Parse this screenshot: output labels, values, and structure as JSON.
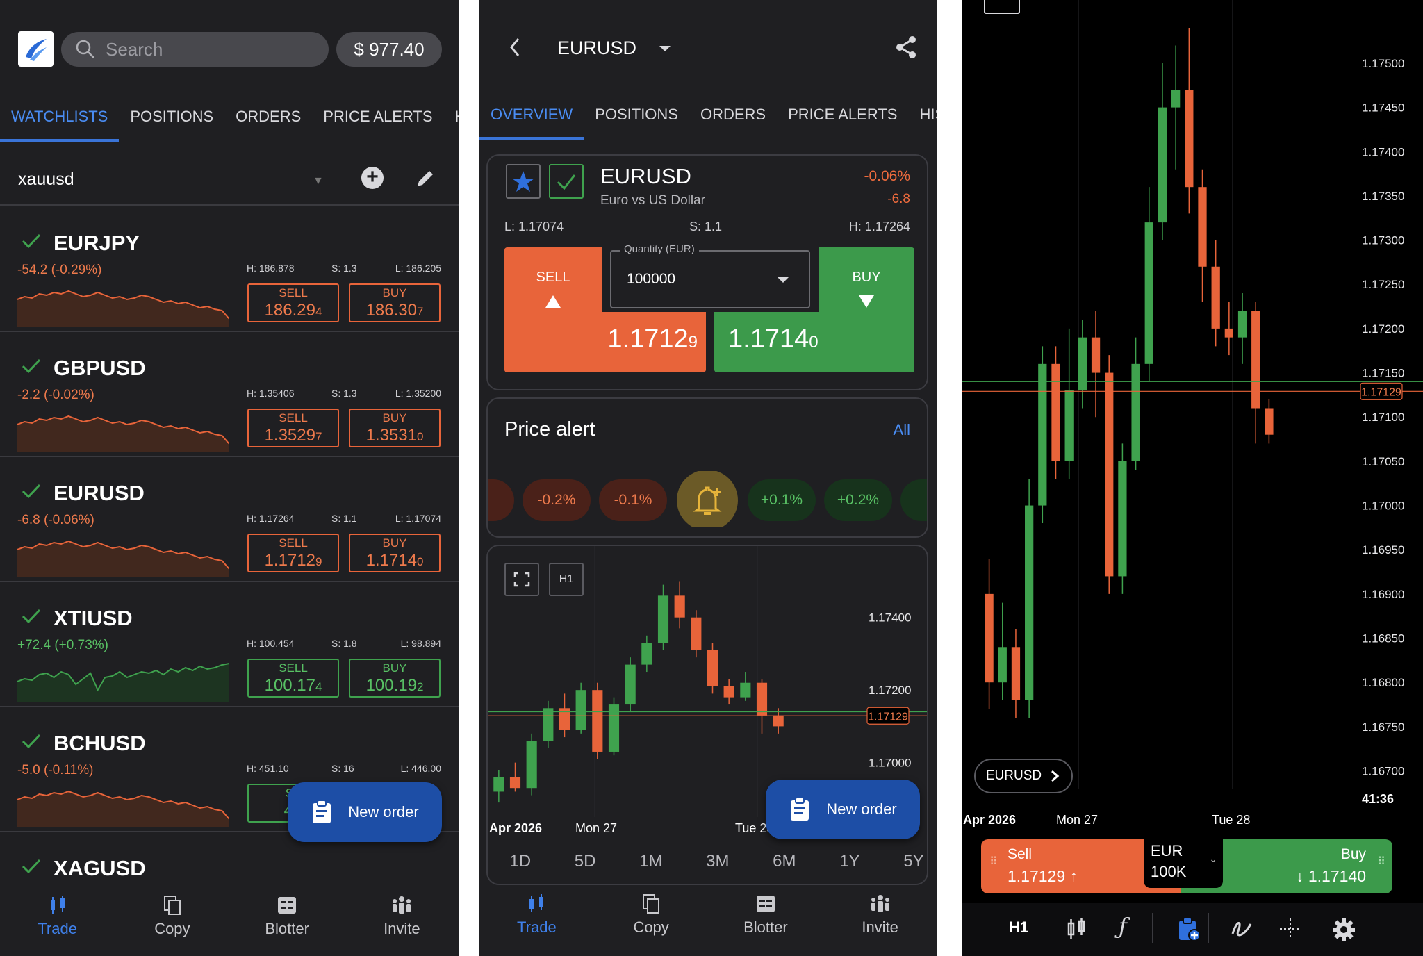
{
  "colors": {
    "accent": "#3a74d8",
    "sell": "#e8643a",
    "buy": "#3c9a4b",
    "panel_bg": "#1f1f22"
  },
  "panel1": {
    "search_placeholder": "Search",
    "balance": "$ 977.40",
    "tabs": [
      "WATCHLISTS",
      "POSITIONS",
      "ORDERS",
      "PRICE ALERTS",
      "HIS"
    ],
    "watchlist_name": "xauusd",
    "rows": [
      {
        "symbol": "EURJPY",
        "change": "-54.2 (-0.29%)",
        "trend": "down",
        "high": "H: 186.878",
        "spread": "S: 1.3",
        "low": "L: 186.205",
        "sell_label": "SELL",
        "sell_main": "186.29",
        "sell_pip": "4",
        "buy_label": "BUY",
        "buy_main": "186.30",
        "buy_pip": "7",
        "style": "orange"
      },
      {
        "symbol": "GBPUSD",
        "change": "-2.2 (-0.02%)",
        "trend": "down",
        "high": "H: 1.35406",
        "spread": "S: 1.3",
        "low": "L: 1.35200",
        "sell_label": "SELL",
        "sell_main": "1.3529",
        "sell_pip": "7",
        "buy_label": "BUY",
        "buy_main": "1.3531",
        "buy_pip": "0",
        "style": "orange"
      },
      {
        "symbol": "EURUSD",
        "change": "-6.8 (-0.06%)",
        "trend": "down",
        "high": "H: 1.17264",
        "spread": "S: 1.1",
        "low": "L: 1.17074",
        "sell_label": "SELL",
        "sell_main": "1.1712",
        "sell_pip": "9",
        "buy_label": "BUY",
        "buy_main": "1.1714",
        "buy_pip": "0",
        "style": "orange"
      },
      {
        "symbol": "XTIUSD",
        "change": "+72.4 (+0.73%)",
        "trend": "up",
        "high": "H: 100.454",
        "spread": "S: 1.8",
        "low": "L: 98.894",
        "sell_label": "SELL",
        "sell_main": "100.17",
        "sell_pip": "4",
        "buy_label": "BUY",
        "buy_main": "100.19",
        "buy_pip": "2",
        "style": "green"
      },
      {
        "symbol": "BCHUSD",
        "change": "-5.0 (-0.11%)",
        "trend": "down",
        "high": "H: 451.10",
        "spread": "S: 16",
        "low": "L: 446.00",
        "sell_label": "SE",
        "sell_main": "44",
        "sell_pip": "",
        "buy_label": "",
        "buy_main": "",
        "buy_pip": "",
        "style": "green"
      },
      {
        "symbol": "XAGUSD",
        "change": "",
        "trend": "",
        "high": "",
        "spread": "",
        "low": "",
        "sell_label": "",
        "sell_main": "",
        "sell_pip": "",
        "buy_label": "",
        "buy_main": "",
        "buy_pip": "",
        "style": "green"
      }
    ],
    "new_order": "New order",
    "nav": [
      "Trade",
      "Copy",
      "Blotter",
      "Invite"
    ]
  },
  "panel2": {
    "title": "EURUSD",
    "tabs": [
      "OVERVIEW",
      "POSITIONS",
      "ORDERS",
      "PRICE ALERTS",
      "HISTO"
    ],
    "symbol": "EURUSD",
    "description": "Euro vs US Dollar",
    "change_pct": "-0.06%",
    "change_abs": "-6.8",
    "low": "L: 1.17074",
    "spread": "S: 1.1",
    "high": "H: 1.17264",
    "sell_label": "SELL",
    "buy_label": "BUY",
    "quantity_label": "Quantity (EUR)",
    "quantity_value": "100000",
    "sell_main": "1.1712",
    "sell_pip": "9",
    "buy_main": "1.1714",
    "buy_pip": "0",
    "price_alert_title": "Price alert",
    "price_alert_all": "All",
    "chips": [
      "%",
      "-0.2%",
      "-0.1%",
      "+0.1%",
      "+0.2%",
      "+("
    ],
    "chart_timeframe": "H1",
    "timeframes": [
      "1D",
      "5D",
      "1M",
      "3M",
      "6M",
      "1Y",
      "5Y"
    ],
    "new_order": "New order",
    "nav": [
      "Trade",
      "Copy",
      "Blotter",
      "Invite"
    ]
  },
  "panel3": {
    "symbol_pill": "EURUSD",
    "time_label": "41:36",
    "sell_label": "Sell",
    "sell_price": "1.17129",
    "buy_label": "Buy",
    "buy_price": "1.17140",
    "currency": "EUR",
    "amount": "100K",
    "timeframe": "H1"
  },
  "chart_data": [
    {
      "type": "candlestick",
      "id": "overview-chart",
      "x_labels": [
        "Apr 2026",
        "Mon 27",
        "Tue 28"
      ],
      "y_ticks": [
        "1.17400",
        "1.17200",
        "1.17000"
      ],
      "current_sell": "1.17129",
      "current_buy": 1.1714,
      "ylim": [
        1.1685,
        1.1752
      ],
      "candles": [
        [
          1.1692,
          1.1696,
          1.1689,
          1.1698
        ],
        [
          1.1696,
          1.1693,
          1.1692,
          1.17
        ],
        [
          1.1693,
          1.1706,
          1.1691,
          1.1708
        ],
        [
          1.1706,
          1.1715,
          1.1704,
          1.1717
        ],
        [
          1.1715,
          1.1709,
          1.1707,
          1.1719
        ],
        [
          1.1709,
          1.172,
          1.1708,
          1.1722
        ],
        [
          1.172,
          1.1703,
          1.1701,
          1.1722
        ],
        [
          1.1703,
          1.1716,
          1.1702,
          1.1718
        ],
        [
          1.1716,
          1.1727,
          1.1714,
          1.1729
        ],
        [
          1.1727,
          1.1733,
          1.1725,
          1.1735
        ],
        [
          1.1733,
          1.1746,
          1.1731,
          1.1749
        ],
        [
          1.1746,
          1.174,
          1.1737,
          1.175
        ],
        [
          1.174,
          1.1731,
          1.1729,
          1.1742
        ],
        [
          1.1731,
          1.1721,
          1.1719,
          1.1733
        ],
        [
          1.1721,
          1.1718,
          1.1716,
          1.1723
        ],
        [
          1.1718,
          1.1722,
          1.1717,
          1.1725
        ],
        [
          1.1722,
          1.1713,
          1.1708,
          1.1723
        ],
        [
          1.1713,
          1.171,
          1.1708,
          1.1715
        ]
      ]
    },
    {
      "type": "candlestick",
      "id": "fullscreen-chart",
      "x_labels": [
        "Apr 2026",
        "Mon 27",
        "Tue 28"
      ],
      "y_ticks": [
        "1.17500",
        "1.17450",
        "1.17400",
        "1.17350",
        "1.17300",
        "1.17250",
        "1.17200",
        "1.17150",
        "1.17100",
        "1.17050",
        "1.17000",
        "1.16950",
        "1.16900",
        "1.16850",
        "1.16800",
        "1.16750",
        "1.16700"
      ],
      "current_sell": 1.17129,
      "current_buy": 1.1714,
      "ylim": [
        1.1668,
        1.1754
      ],
      "candles": [
        [
          1.169,
          1.168,
          1.1677,
          1.1694
        ],
        [
          1.168,
          1.1684,
          1.1678,
          1.1689
        ],
        [
          1.1684,
          1.1678,
          1.1676,
          1.1686
        ],
        [
          1.1678,
          1.17,
          1.1676,
          1.1703
        ],
        [
          1.17,
          1.1716,
          1.1698,
          1.1718
        ],
        [
          1.1716,
          1.1705,
          1.1703,
          1.1718
        ],
        [
          1.1705,
          1.1713,
          1.1703,
          1.172
        ],
        [
          1.1713,
          1.1719,
          1.1711,
          1.1721
        ],
        [
          1.1719,
          1.1715,
          1.171,
          1.1722
        ],
        [
          1.1715,
          1.1692,
          1.169,
          1.1717
        ],
        [
          1.1692,
          1.1705,
          1.169,
          1.1707
        ],
        [
          1.1705,
          1.1716,
          1.1704,
          1.1719
        ],
        [
          1.1716,
          1.1732,
          1.1714,
          1.1736
        ],
        [
          1.1732,
          1.1745,
          1.173,
          1.175
        ],
        [
          1.1745,
          1.1747,
          1.1738,
          1.1752
        ],
        [
          1.1747,
          1.1736,
          1.1733,
          1.1754
        ],
        [
          1.1736,
          1.1727,
          1.1723,
          1.1738
        ],
        [
          1.1727,
          1.172,
          1.1718,
          1.173
        ],
        [
          1.172,
          1.1719,
          1.1717,
          1.1723
        ],
        [
          1.1719,
          1.1722,
          1.1716,
          1.1724
        ],
        [
          1.1722,
          1.1711,
          1.1707,
          1.1723
        ],
        [
          1.1711,
          1.1708,
          1.1707,
          1.1712
        ]
      ]
    }
  ]
}
